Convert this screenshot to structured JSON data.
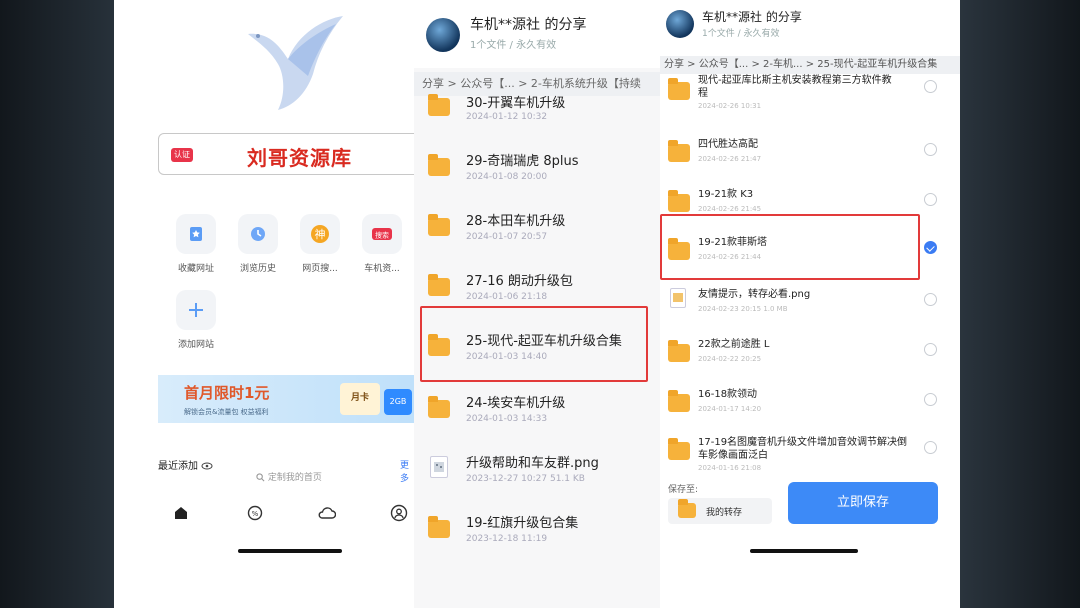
{
  "left_panel": {
    "brand_tag": "认证",
    "brand_title": "刘哥资源库",
    "apps": [
      {
        "icon": "bookmark-icon",
        "label": "收藏网址"
      },
      {
        "icon": "history-icon",
        "label": "浏览历史"
      },
      {
        "icon": "webpage-search-icon",
        "label": "网页搜..."
      },
      {
        "icon": "car-resource-icon",
        "label": "车机资..."
      },
      {
        "icon": "plus-icon",
        "label": "添加网站"
      }
    ],
    "banner": {
      "main": "首月限时1元",
      "sub": "解锁会员&流量包 权益福利",
      "card": "月卡",
      "card2": "2GB"
    },
    "recent_label": "最近添加",
    "recent_right": "更多",
    "custom_homepage": "定制我的首页"
  },
  "middle_panel": {
    "share_title": "车机**源社 的分享",
    "share_sub": "1个文件 / 永久有效",
    "breadcrumb": "分享 > 公众号【... > 2-车机系统升级【持续",
    "items": [
      {
        "name": "30-开翼车机升级",
        "date": "2024-01-12 10:32",
        "type": "folder"
      },
      {
        "name": "29-奇瑞瑞虎 8plus",
        "date": "2024-01-08 20:00",
        "type": "folder"
      },
      {
        "name": "28-本田车机升级",
        "date": "2024-01-07 20:57",
        "type": "folder"
      },
      {
        "name": "27-16 朗动升级包",
        "date": "2024-01-06 21:18",
        "type": "folder"
      },
      {
        "name": "25-现代-起亚车机升级合集",
        "date": "2024-01-03 14:40",
        "type": "folder"
      },
      {
        "name": "24-埃安车机升级",
        "date": "2024-01-03 14:33",
        "type": "folder"
      },
      {
        "name": "升级帮助和车友群.png",
        "date": "2023-12-27 10:27",
        "size": "51.1 KB",
        "type": "image"
      },
      {
        "name": "19-红旗升级包合集",
        "date": "2023-12-18 11:19",
        "type": "folder"
      }
    ]
  },
  "right_panel": {
    "share_title": "车机**源社 的分享",
    "share_sub": "1个文件 / 永久有效",
    "breadcrumb": "分享 > 公众号【... > 2-车机... > 25-现代-起亚车机升级合集",
    "items": [
      {
        "name": "现代-起亚库比斯主机安装教程第三方软件教程",
        "date": "2024-02-26 10:31",
        "type": "folder",
        "checked": false
      },
      {
        "name": "四代胜达高配",
        "date": "2024-02-26 21:47",
        "type": "folder",
        "checked": false
      },
      {
        "name": "19-21款 K3",
        "date": "2024-02-26 21:45",
        "type": "folder",
        "checked": false
      },
      {
        "name": "19-21款菲斯塔",
        "date": "2024-02-26 21:44",
        "type": "folder",
        "checked": true
      },
      {
        "name": "友情提示，转存必看.png",
        "date": "2024-02-23 20:15",
        "size": "1.0 MB",
        "type": "image",
        "checked": false
      },
      {
        "name": "22款之前途胜 L",
        "date": "2024-02-22 20:25",
        "type": "folder",
        "checked": false
      },
      {
        "name": "16-18款领动",
        "date": "2024-01-17 14:20",
        "type": "folder",
        "checked": false
      },
      {
        "name": "17-19名图魔音机升级文件增加音效调节解决倒车影像画面泛白",
        "date": "2024-01-16 21:08",
        "type": "folder",
        "checked": false
      }
    ],
    "save_to_label": "保存至:",
    "save_dest": "我的转存",
    "save_button": "立即保存"
  },
  "colors": {
    "highlight_box": "#e23a3a",
    "folder": "#f6b23b",
    "primary_button": "#3d8af7",
    "brand_red": "#d92a20"
  }
}
